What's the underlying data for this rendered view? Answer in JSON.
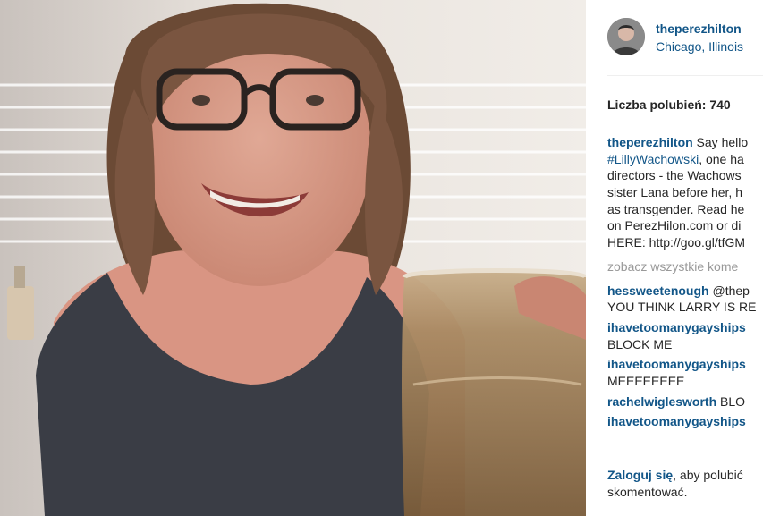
{
  "post": {
    "username": "theperezhilton",
    "location": "Chicago, Illinois",
    "likes": "Liczba polubień: 740",
    "caption": {
      "username": "theperezhilton",
      "line1": " Say hello",
      "hashtag": "#LillyWachowski",
      "line2_rest": ", one ha",
      "line3": "directors - the Wachows",
      "line4": "sister Lana before her, h",
      "line5": "as transgender. Read he",
      "line6": "on PerezHilon.com or di",
      "line7": "HERE: http://goo.gl/tfGM"
    },
    "see_all": "zobacz wszystkie kome",
    "comments": [
      {
        "user": "hessweetenough",
        "text": " @thep",
        "line2": "YOU THINK LARRY IS RE"
      },
      {
        "user": "ihavetoomanygayships",
        "text": "",
        "line2": "BLOCK ME"
      },
      {
        "user": "ihavetoomanygayships",
        "text": "",
        "line2": "MEEEEEEEE"
      },
      {
        "user": "rachelwiglesworth",
        "text": " BLO",
        "line2": ""
      },
      {
        "user": "ihavetoomanygayships",
        "text": "",
        "line2": ""
      }
    ],
    "login": {
      "link": "Zaloguj się",
      "rest": ", aby polubić",
      "line2": "skomentować."
    }
  },
  "colors": {
    "link": "#125688",
    "muted": "#999999",
    "text": "#262626"
  },
  "icons": {
    "avatar": "profile-photo"
  }
}
